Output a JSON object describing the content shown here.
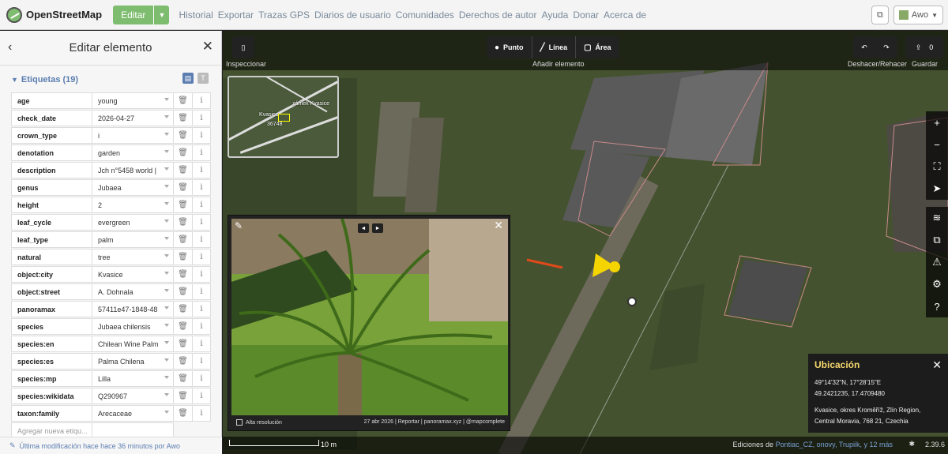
{
  "brand": {
    "name": "OpenStreetMap"
  },
  "header": {
    "edit_label": "Editar",
    "nav": [
      "Historial",
      "Exportar",
      "Trazas GPS",
      "Diarios de usuario",
      "Comunidades",
      "Derechos de autor",
      "Ayuda",
      "Donar",
      "Acerca de"
    ],
    "user": "Awo"
  },
  "sidebar": {
    "title": "Editar elemento",
    "tags_header": "Etiquetas (19)",
    "tags": [
      {
        "key": "age",
        "value": "young"
      },
      {
        "key": "check_date",
        "value": "2026-04-27"
      },
      {
        "key": "crown_type",
        "value": "i"
      },
      {
        "key": "denotation",
        "value": "garden"
      },
      {
        "key": "description",
        "value": "Jch n°5458 world |"
      },
      {
        "key": "genus",
        "value": "Jubaea"
      },
      {
        "key": "height",
        "value": "2"
      },
      {
        "key": "leaf_cycle",
        "value": "evergreen"
      },
      {
        "key": "leaf_type",
        "value": "palm"
      },
      {
        "key": "natural",
        "value": "tree"
      },
      {
        "key": "object:city",
        "value": "Kvasice"
      },
      {
        "key": "object:street",
        "value": "A. Dohnala"
      },
      {
        "key": "panoramax",
        "value": "57411e47-1848-48"
      },
      {
        "key": "species",
        "value": "Jubaea chilensis"
      },
      {
        "key": "species:en",
        "value": "Chilean Wine Palm"
      },
      {
        "key": "species:es",
        "value": "Palma Chilena"
      },
      {
        "key": "species:mp",
        "value": "Lilla"
      },
      {
        "key": "species:wikidata",
        "value": "Q290967"
      },
      {
        "key": "taxon:family",
        "value": "Arecaceae"
      }
    ],
    "add_tag_placeholder": "Agregar nueva etiqu...",
    "footer": "Última modificación hace hace 36 minutos por Awo"
  },
  "map_toolbar": {
    "inspect_label": "Inspeccionar",
    "modes": [
      "Punto",
      "Línea",
      "Área"
    ],
    "add_label": "Añadir elemento",
    "undo_redo_label": "Deshacer/Rehacer",
    "save_label": "Guardar",
    "save_count": "0"
  },
  "minimap": {
    "labels": [
      "Kvasice",
      "zámek Kvasice",
      "36748"
    ]
  },
  "photo": {
    "hires_label": "Alta resolución",
    "date": "27 abr 2026",
    "report": "Reportar",
    "source": "panoramax.xyz",
    "author": "@mapcomplete"
  },
  "location": {
    "title": "Ubicación",
    "dms": "49°14'32\"N, 17°28'15\"E",
    "decimal": "49.2421235, 17.4709480",
    "address1": "Kvasice, okres Kroměříž, Zlín Region,",
    "address2": "Central Moravia, 768 21, Czechia"
  },
  "map_footer": {
    "scale": "10 m",
    "credits_prefix": "Ediciones de",
    "credit_users": "Pontiac_CZ, onovy, Trupiik,",
    "credits_more": "y 12 más",
    "version": "2.39.6"
  },
  "colors": {
    "accent": "#7ebc6f",
    "link": "#5b7db1",
    "location_title": "#f5d76e",
    "marker": "#f5d500"
  }
}
